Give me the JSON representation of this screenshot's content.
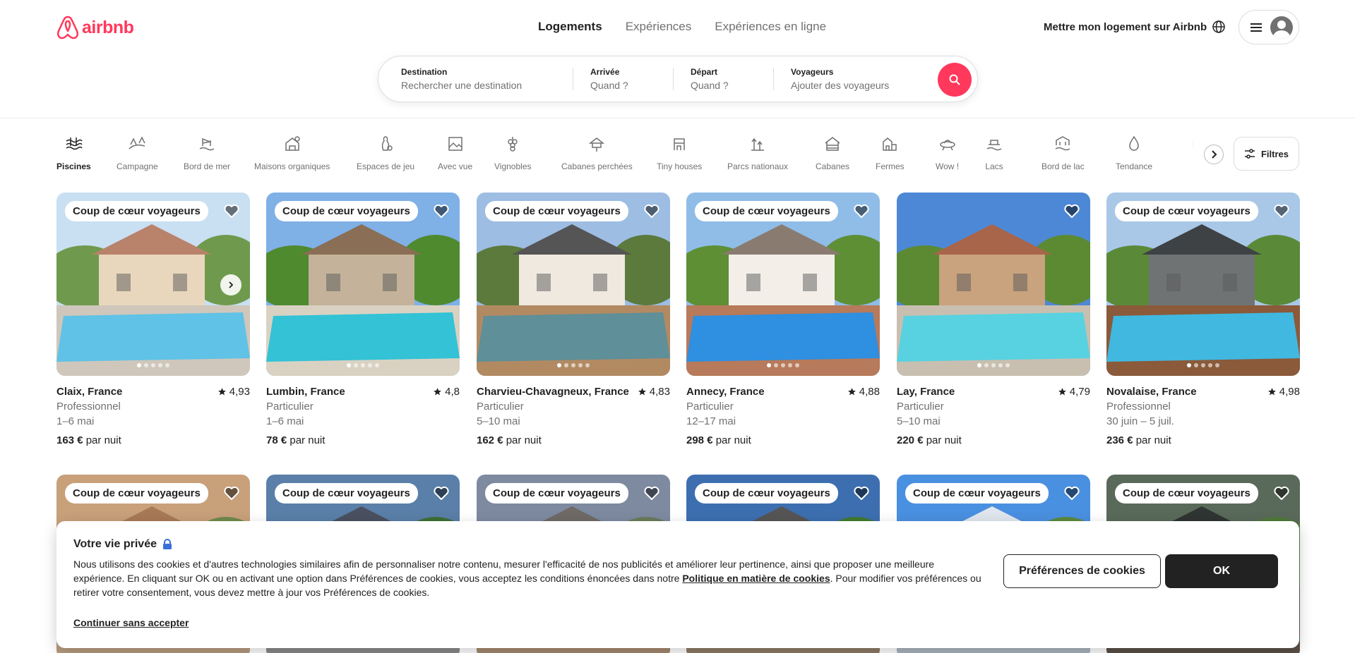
{
  "brand": {
    "name": "airbnb",
    "color": "#FF385C"
  },
  "top_nav": {
    "tabs": [
      "Logements",
      "Expériences",
      "Expériences en ligne"
    ],
    "active": "Logements"
  },
  "header": {
    "host_link": "Mettre mon logement sur Airbnb"
  },
  "search": {
    "destination": {
      "label": "Destination",
      "placeholder": "Rechercher une destination"
    },
    "arrival": {
      "label": "Arrivée",
      "placeholder": "Quand ?"
    },
    "departure": {
      "label": "Départ",
      "placeholder": "Quand ?"
    },
    "guests": {
      "label": "Voyageurs",
      "placeholder": "Ajouter des voyageurs"
    }
  },
  "categories": [
    {
      "label": "Piscines",
      "icon": "pool-icon",
      "active": true
    },
    {
      "label": "Campagne",
      "icon": "countryside-icon"
    },
    {
      "label": "Bord de mer",
      "icon": "beachfront-icon"
    },
    {
      "label": "Maisons organiques",
      "icon": "organic-house-icon"
    },
    {
      "label": "Espaces de jeu",
      "icon": "bowling-pin-icon"
    },
    {
      "label": "Avec vue",
      "icon": "picture-frame-icon"
    },
    {
      "label": "Vignobles",
      "icon": "grapes-icon"
    },
    {
      "label": "Cabanes perchées",
      "icon": "treehouse-icon"
    },
    {
      "label": "Tiny houses",
      "icon": "tiny-house-icon"
    },
    {
      "label": "Parcs nationaux",
      "icon": "national-park-icon"
    },
    {
      "label": "Cabanes",
      "icon": "cabin-icon"
    },
    {
      "label": "Fermes",
      "icon": "farm-icon"
    },
    {
      "label": "Wow !",
      "icon": "ufo-icon"
    },
    {
      "label": "Lacs",
      "icon": "lake-icon"
    },
    {
      "label": "Bord de lac",
      "icon": "lakefront-icon"
    },
    {
      "label": "Tendance",
      "icon": "flame-icon"
    },
    {
      "label": "Se",
      "icon": "more-icon"
    }
  ],
  "filters": {
    "label": "Filtres"
  },
  "listings": [
    {
      "badge": "Coup de cœur voyageurs",
      "location": "Claix, France",
      "rating": "4,93",
      "host": "Professionnel",
      "dates": "1–6 mai",
      "price": "163 €",
      "price_suffix": "par nuit",
      "colors": {
        "sky": "#c9dff2",
        "building": "#e9d7bd",
        "roof": "#b9826a",
        "green": "#6f9a4d",
        "pool": "#5fc2e6",
        "deck": "#cfc7bb"
      }
    },
    {
      "badge": "Coup de cœur voyageurs",
      "location": "Lumbin, France",
      "rating": "4,8",
      "host": "Particulier",
      "dates": "1–6 mai",
      "price": "78 €",
      "price_suffix": "par nuit",
      "colors": {
        "sky": "#7fb0e6",
        "building": "#c4b39a",
        "roof": "#8a6e55",
        "green": "#4f8a2f",
        "pool": "#33c2d6",
        "deck": "#d9d2c3"
      }
    },
    {
      "badge": "Coup de cœur voyageurs",
      "location": "Charvieu-Chavagneux, France",
      "rating": "4,83",
      "host": "Particulier",
      "dates": "5–10 mai",
      "price": "162 €",
      "price_suffix": "par nuit",
      "colors": {
        "sky": "#9dbde3",
        "building": "#efe9df",
        "roof": "#555555",
        "green": "#5b7a3c",
        "pool": "#5f8f98",
        "deck": "#b28a62"
      }
    },
    {
      "badge": "Coup de cœur voyageurs",
      "location": "Annecy, France",
      "rating": "4,88",
      "host": "Particulier",
      "dates": "12–17 mai",
      "price": "298 €",
      "price_suffix": "par nuit",
      "colors": {
        "sky": "#8fbde8",
        "building": "#f3efe8",
        "roof": "#8a7b70",
        "green": "#5e8f35",
        "pool": "#2f8fe0",
        "deck": "#b77a5a"
      }
    },
    {
      "badge": "",
      "location": "Lay, France",
      "rating": "4,79",
      "host": "Particulier",
      "dates": "5–10 mai",
      "price": "220 €",
      "price_suffix": "par nuit",
      "colors": {
        "sky": "#4d88d6",
        "building": "#c9a37e",
        "roof": "#a8654a",
        "green": "#5c8a33",
        "pool": "#58d2e0",
        "deck": "#c9bfb0"
      }
    },
    {
      "badge": "Coup de cœur voyageurs",
      "location": "Novalaise, France",
      "rating": "4,98",
      "host": "Professionnel",
      "dates": "30 juin – 5 juil.",
      "price": "236 €",
      "price_suffix": "par nuit",
      "colors": {
        "sky": "#a9c8e8",
        "building": "#6f7374",
        "roof": "#3e4244",
        "green": "#5a8a38",
        "pool": "#41b8e0",
        "deck": "#8a5a3a"
      }
    },
    {
      "badge": "Coup de cœur voyageurs",
      "location": "",
      "rating": "",
      "host": "",
      "dates": "",
      "price": "",
      "price_suffix": "",
      "colors": {
        "sky": "#c8a07a",
        "building": "#d9b48e",
        "roof": "#a87955",
        "green": "#6f8a4a",
        "pool": "#5fb0c9",
        "deck": "#b89c80"
      }
    },
    {
      "badge": "Coup de cœur voyageurs",
      "location": "",
      "rating": "",
      "host": "",
      "dates": "",
      "price": "",
      "price_suffix": "",
      "colors": {
        "sky": "#5a7fa8",
        "building": "#c8c8cc",
        "roof": "#4a5060",
        "green": "#3e6e35",
        "pool": "#3d8fb5",
        "deck": "#8a8a8a"
      }
    },
    {
      "badge": "Coup de cœur voyageurs",
      "location": "",
      "rating": "",
      "host": "",
      "dates": "",
      "price": "",
      "price_suffix": "",
      "colors": {
        "sky": "#7d8aa0",
        "building": "#dddad5",
        "roof": "#6f6a66",
        "green": "#6a7a5a",
        "pool": "#7aa8b8",
        "deck": "#a58a70"
      }
    },
    {
      "badge": "Coup de cœur voyageurs",
      "location": "",
      "rating": "",
      "host": "",
      "dates": "",
      "price": "",
      "price_suffix": "",
      "colors": {
        "sky": "#3d6fb0",
        "building": "#cfd8e0",
        "roof": "#555",
        "green": "#3f7a30",
        "pool": "#3aa0d8",
        "deck": "#8f7b66"
      }
    },
    {
      "badge": "Coup de cœur voyageurs",
      "location": "",
      "rating": "",
      "host": "",
      "dates": "",
      "price": "",
      "price_suffix": "",
      "colors": {
        "sky": "#4a90e0",
        "building": "#ffffff",
        "roof": "#e0e6ee",
        "green": "#5b8a3c",
        "pool": "#7ec0e8",
        "deck": "#aab4be"
      }
    },
    {
      "badge": "Coup de cœur voyageurs",
      "location": "",
      "rating": "",
      "host": "",
      "dates": "",
      "price": "",
      "price_suffix": "",
      "colors": {
        "sky": "#5a6a5a",
        "building": "#3f4a45",
        "roof": "#2f3532",
        "green": "#4f7a3a",
        "pool": "#2e6f8a",
        "deck": "#5a5048"
      }
    }
  ],
  "cookie": {
    "title": "Votre vie privée",
    "text_before": "Nous utilisons des cookies et d'autres technologies similaires afin de personnaliser notre contenu, mesurer l'efficacité de nos publicités et améliorer leur pertinence, ainsi que proposer une meilleure expérience. En cliquant sur OK ou en activant une option dans Préférences de cookies, vous acceptez les conditions énoncées dans notre ",
    "policy_link": "Politique en matière de cookies",
    "text_after": ". Pour modifier vos préférences ou retirer votre consentement, vous devez mettre à jour vos Préférences de cookies.",
    "skip_link": "Continuer sans accepter",
    "prefs_button": "Préférences de cookies",
    "ok_button": "OK"
  }
}
